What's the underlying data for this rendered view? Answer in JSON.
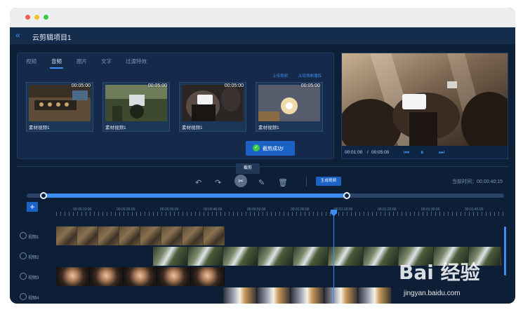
{
  "project": {
    "title": "云剪辑项目1"
  },
  "media_panel": {
    "tabs": [
      {
        "label": "视频"
      },
      {
        "label": "音频"
      },
      {
        "label": "图片"
      },
      {
        "label": "文字"
      },
      {
        "label": "过渡特效"
      }
    ],
    "upload_video": "上传视频",
    "import_from_live": "从现场断播拣",
    "clips": [
      {
        "name": "素材视频1",
        "duration": "00:05:00"
      },
      {
        "name": "素材视频1",
        "duration": "00:05:00"
      },
      {
        "name": "素材视频1",
        "duration": "00:05:00"
      },
      {
        "name": "素材视频1",
        "duration": "00:05:00"
      }
    ],
    "toast": "截剪成功!"
  },
  "preview": {
    "time_current": "00:01:00",
    "time_separator": "/",
    "time_total": "00:05:00"
  },
  "toolbar": {
    "tooltip": "截剪",
    "generate_button": "生成视频",
    "current_time_label": "当前时间：",
    "current_time_value": "00:00:40:15"
  },
  "ruler": {
    "ticks": [
      "00:00:10:00",
      "00:00:20:00",
      "00:00:30:00",
      "00:00:40:00",
      "00:00:50:00",
      "00:01:00:00",
      "00:01:10:00",
      "00:01:20:00",
      "00:01:30:00",
      "00:01:40:00"
    ]
  },
  "tracks": [
    {
      "label": "视频1"
    },
    {
      "label": "视频2"
    },
    {
      "label": "视频3"
    },
    {
      "label": "视频4"
    }
  ],
  "watermark": {
    "logo_text": "Bai 经验",
    "url": "jingyan.baidu.com"
  },
  "colors": {
    "accent": "#3d8ef0",
    "panel": "#15294a",
    "background": "#0e2038"
  },
  "icons": [
    "back-icon",
    "undo-icon",
    "redo-icon",
    "scissors-icon",
    "edit-icon",
    "trash-icon",
    "add-icon",
    "prev-icon",
    "pause-icon",
    "next-icon",
    "check-icon"
  ]
}
